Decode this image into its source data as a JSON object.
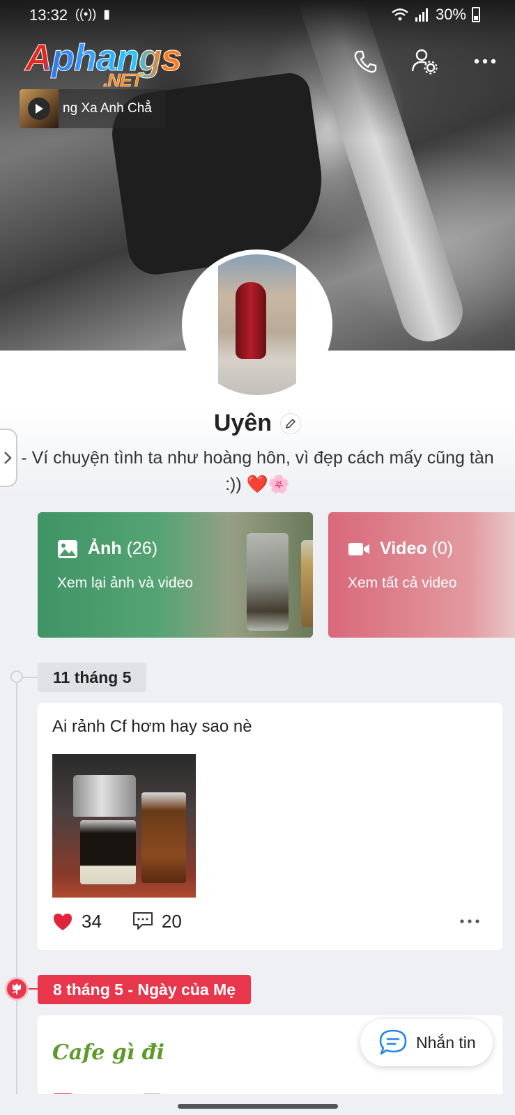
{
  "status_bar": {
    "time": "13:32",
    "battery": "30%",
    "icons": [
      "hotspot-icon",
      "battery-saver-icon",
      "wifi-icon",
      "signal-icon",
      "battery-icon"
    ]
  },
  "logo": {
    "line1": "Aphangs",
    "line2": ".NET"
  },
  "header": {
    "icons": [
      "phone-icon",
      "user-settings-icon",
      "more-icon"
    ]
  },
  "music": {
    "title": "ng Xa Anh Chẳ"
  },
  "profile": {
    "name": "Uyên",
    "bio": "- Ví chuyện tình ta như hoàng hôn, vì đẹp cách mấy cũng tàn :)) ❤️🌸"
  },
  "media": {
    "photos": {
      "label": "Ảnh",
      "count": "(26)",
      "subtitle": "Xem lại ảnh và video"
    },
    "videos": {
      "label": "Video",
      "count": "(0)",
      "subtitle": "Xem tất cả video"
    }
  },
  "timeline": [
    {
      "date": "11 tháng 5",
      "text": "Ai rảnh Cf hơm hay sao nè",
      "likes": "34",
      "comments": "20"
    },
    {
      "date": "8 tháng 5 - Ngày của Mẹ",
      "text": "Cafe gì đi"
    }
  ],
  "chat_button": {
    "label": "Nhắn tin"
  },
  "colors": {
    "accent_red": "#e8374d",
    "photo_green": "#3f9466",
    "video_pink": "#d9687a",
    "chat_blue": "#1e88e5"
  }
}
